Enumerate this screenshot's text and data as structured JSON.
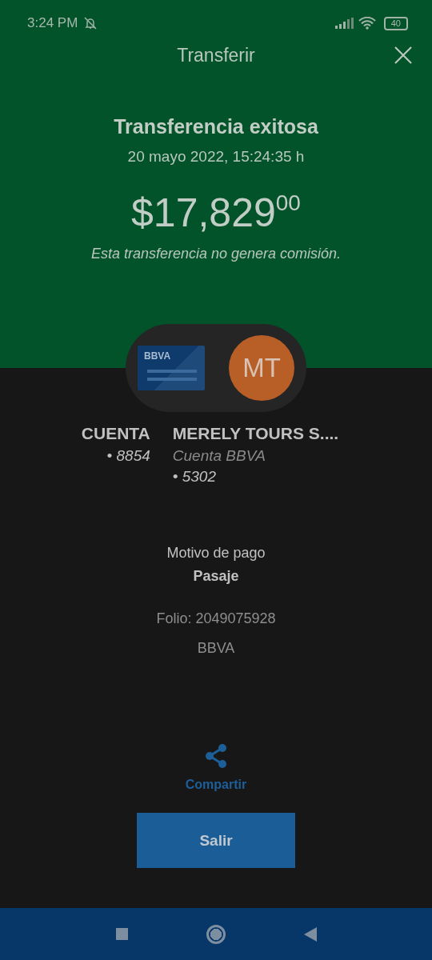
{
  "status_bar": {
    "time": "3:24 PM",
    "battery": "40"
  },
  "header": {
    "title": "Transferir"
  },
  "result": {
    "title": "Transferencia exitosa",
    "date": "20 mayo 2022, 15:24:35 h",
    "amount": "$17,829$^{00}$",
    "note": "Esta transferencia no genera comisión."
  },
  "origin": {
    "card_brand": "BBVA",
    "name": "CUENTA",
    "number": "• 8854"
  },
  "destination": {
    "initials": "MT",
    "name": "MERELY TOURS S....",
    "bank": "Cuenta BBVA",
    "number": "• 5302"
  },
  "details": {
    "label": "Motivo de pago",
    "value": "Pasaje",
    "folio": "Folio: 2049075928",
    "bank": "BBVA"
  },
  "share": {
    "label": "Compartir"
  },
  "exit_button": {
    "label": "Salir"
  }
}
